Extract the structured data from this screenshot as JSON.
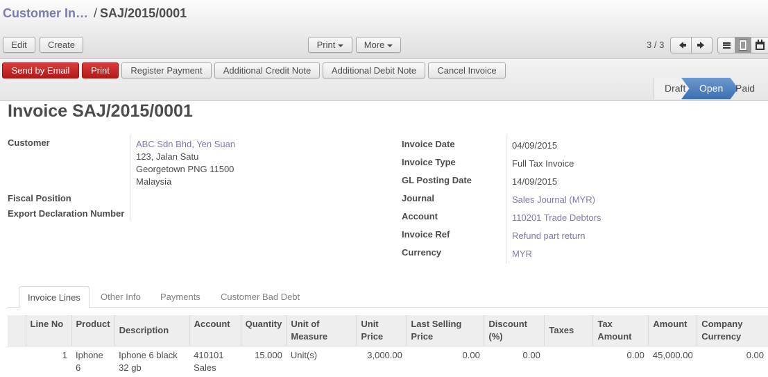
{
  "breadcrumb": {
    "parent": "Customer In…",
    "separator": "/",
    "current": "SAJ/2015/0001"
  },
  "toolbar": {
    "edit_label": "Edit",
    "create_label": "Create",
    "print_label": "Print",
    "more_label": "More",
    "pager_text": "3 / 3",
    "views": [
      {
        "name": "list-view",
        "icon": "list-icon",
        "active": false
      },
      {
        "name": "form-view",
        "icon": "form-icon",
        "active": true
      },
      {
        "name": "calendar-view",
        "icon": "calendar-icon",
        "active": false
      }
    ]
  },
  "actions": {
    "send_by_email": "Send by Email",
    "print": "Print",
    "register_payment": "Register Payment",
    "additional_credit_note": "Additional Credit Note",
    "additional_debit_note": "Additional Debit Note",
    "cancel_invoice": "Cancel Invoice"
  },
  "status": {
    "steps": [
      "Draft",
      "Open",
      "Paid"
    ],
    "current": "Open",
    "accent": "#3b6fb0"
  },
  "invoice": {
    "title": "Invoice SAJ/2015/0001",
    "left": {
      "customer_label": "Customer",
      "customer_name": "ABC Sdn Bhd, Yen Suan",
      "address_line1": "123, Jalan Satu",
      "address_line2": "Georgetown PNG 11500",
      "address_line3": "Malaysia",
      "fiscal_position_label": "Fiscal Position",
      "fiscal_position_value": "",
      "export_declaration_label": "Export Declaration Number",
      "export_declaration_value": ""
    },
    "right": {
      "invoice_date_label": "Invoice Date",
      "invoice_date": "04/09/2015",
      "invoice_type_label": "Invoice Type",
      "invoice_type": "Full Tax Invoice",
      "gl_posting_date_label": "GL Posting Date",
      "gl_posting_date": "14/09/2015",
      "journal_label": "Journal",
      "journal": "Sales Journal (MYR)",
      "account_label": "Account",
      "account": "110201 Trade Debtors",
      "invoice_ref_label": "Invoice Ref",
      "invoice_ref": "Refund part return",
      "currency_label": "Currency",
      "currency": "MYR"
    }
  },
  "tabs": [
    {
      "label": "Invoice Lines",
      "active": true
    },
    {
      "label": "Other Info",
      "active": false
    },
    {
      "label": "Payments",
      "active": false
    },
    {
      "label": "Customer Bad Debt",
      "active": false
    }
  ],
  "lines": {
    "headers": {
      "line_no": "Line No",
      "product": "Product",
      "description": "Description",
      "account": "Account",
      "quantity": "Quantity",
      "uom_1": "Unit of",
      "uom_2": "Measure",
      "unit_price_1": "Unit",
      "unit_price_2": "Price",
      "last_selling_1": "Last Selling",
      "last_selling_2": "Price",
      "discount_1": "Discount",
      "discount_2": "(%)",
      "taxes": "Taxes",
      "tax_amount_1": "Tax",
      "tax_amount_2": "Amount",
      "amount": "Amount",
      "company_currency_1": "Company",
      "company_currency_2": "Currency"
    },
    "rows": [
      {
        "line_no": "1",
        "product": "Iphone 6",
        "description_1": "Iphone 6 black",
        "description_2": "32 gb",
        "account_1": "410101",
        "account_2": "Sales",
        "quantity": "15.000",
        "uom": "Unit(s)",
        "unit_price": "3,000.00",
        "last_selling_price": "0.00",
        "discount": "0.00",
        "taxes": "",
        "tax_amount": "0.00",
        "amount": "45,000.00",
        "company_currency": "0.00"
      }
    ]
  }
}
